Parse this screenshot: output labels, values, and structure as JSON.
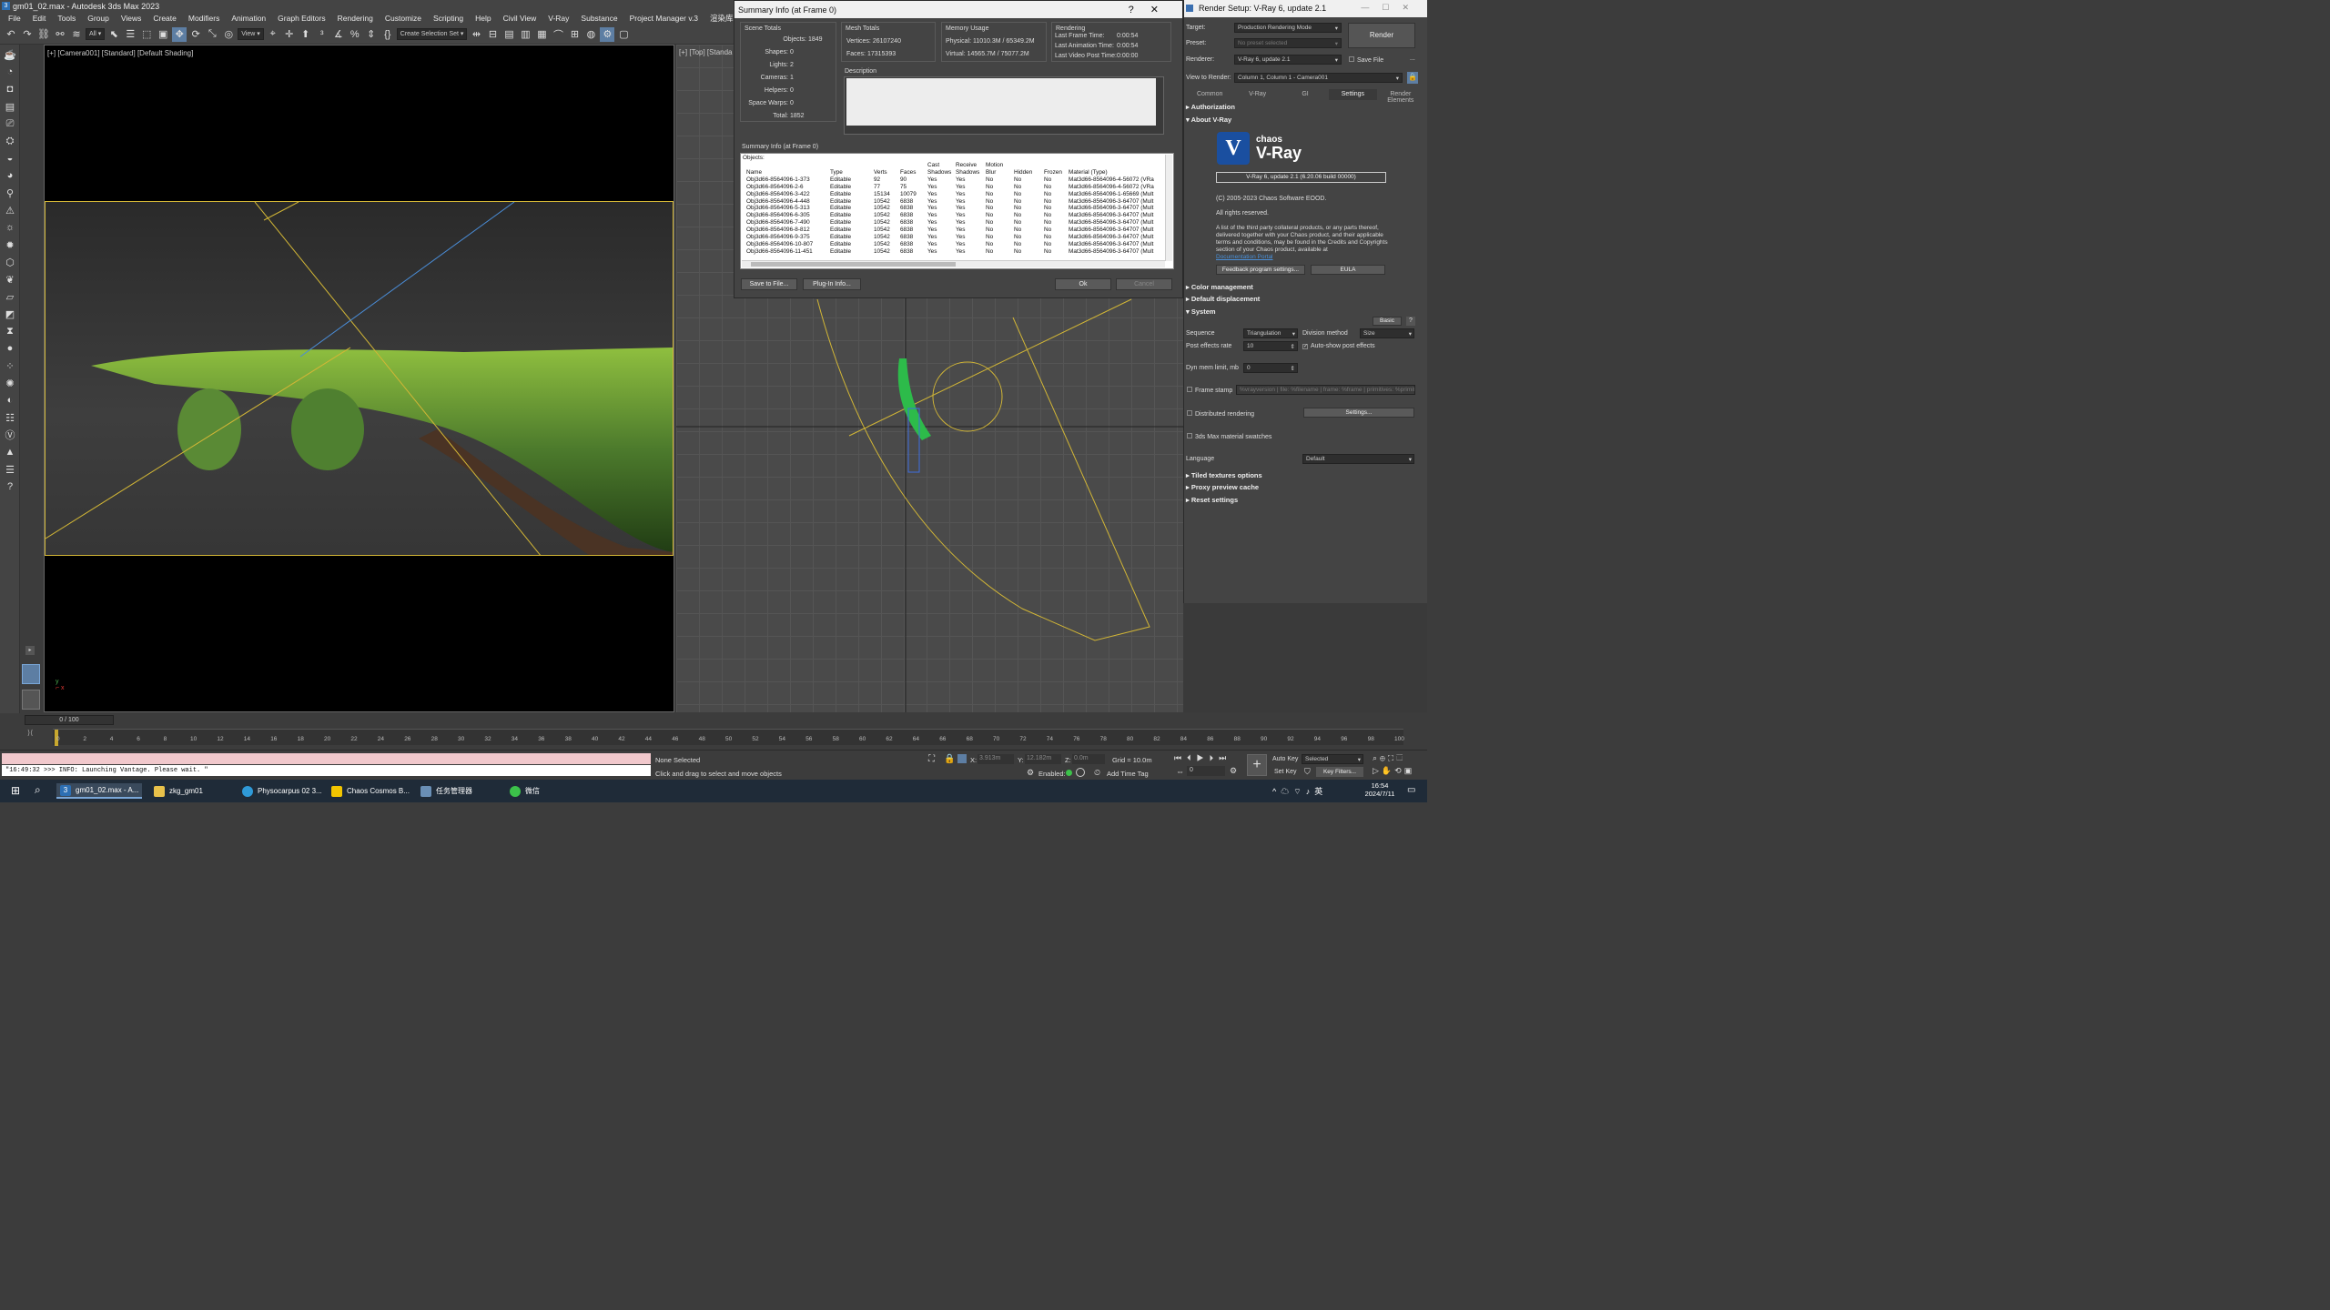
{
  "app": {
    "title": "gm01_02.max - Autodesk 3ds Max 2023",
    "menu": [
      "File",
      "Edit",
      "Tools",
      "Group",
      "Views",
      "Create",
      "Modifiers",
      "Animation",
      "Graph Editors",
      "Rendering",
      "Customize",
      "Scripting",
      "Help",
      "Civil View",
      "V-Ray",
      "Substance",
      "Project Manager v.3",
      "渲染库",
      "小图"
    ],
    "toolbar": {
      "filter": "All",
      "view": "View",
      "selection_set": "Create Selection Set"
    }
  },
  "viewport_left": {
    "label": "[+] [Camera001] [Standard] [Default Shading]"
  },
  "viewport_right": {
    "label": "[+] [Top] [Standa"
  },
  "summary": {
    "title": "Summary Info (at Frame 0)",
    "help": "?",
    "close": "✕",
    "scene_totals": {
      "heading": "Scene Totals",
      "rows": [
        {
          "label": "Objects:",
          "value": "1849"
        },
        {
          "label": "Shapes:",
          "value": "0"
        },
        {
          "label": "Lights:",
          "value": "2"
        },
        {
          "label": "Cameras:",
          "value": "1"
        },
        {
          "label": "Helpers:",
          "value": "0"
        },
        {
          "label": "Space Warps:",
          "value": "0"
        },
        {
          "label": "Total:",
          "value": "1852"
        }
      ]
    },
    "mesh_totals": {
      "heading": "Mesh Totals",
      "rows": [
        {
          "label": "Vertices:",
          "value": "26107240"
        },
        {
          "label": "Faces:",
          "value": "17315393"
        }
      ]
    },
    "memory": {
      "heading": "Memory Usage",
      "rows": [
        {
          "label": "Physical:",
          "value": "11010.3M / 65349.2M"
        },
        {
          "label": "Virtual:",
          "value": "14565.7M / 75077.2M"
        }
      ]
    },
    "rendering": {
      "heading": "Rendering",
      "rows": [
        {
          "label": "Last Frame Time:",
          "value": "0:00:54"
        },
        {
          "label": "Last Animation Time:",
          "value": "0:00:54"
        },
        {
          "label": "Last Video Post Time:",
          "value": "0:00:00"
        }
      ]
    },
    "description_label": "Description",
    "list_label": "Summary Info (at Frame 0)",
    "objects_label": "Objects:",
    "columns": [
      "Name",
      "Type",
      "Verts",
      "Faces",
      "Cast Shadows",
      "Receive Shadows",
      "Motion Blur",
      "Hidden",
      "Frozen",
      "Material (Type)"
    ],
    "rows": [
      [
        "Obj3d66-8564096-1-373",
        "Editable",
        "92",
        "90",
        "Yes",
        "Yes",
        "No",
        "No",
        "No",
        "Mat3d66-8564096-4-56072 (VRa"
      ],
      [
        "Obj3d66-8564096-2-6",
        "Editable",
        "77",
        "75",
        "Yes",
        "Yes",
        "No",
        "No",
        "No",
        "Mat3d66-8564096-4-56072 (VRa"
      ],
      [
        "Obj3d66-8564096-3-422",
        "Editable",
        "15134",
        "10079",
        "Yes",
        "Yes",
        "No",
        "No",
        "No",
        "Mat3d66-8564096-1-65669 (Mult"
      ],
      [
        "Obj3d66-8564096-4-448",
        "Editable",
        "10542",
        "6838",
        "Yes",
        "Yes",
        "No",
        "No",
        "No",
        "Mat3d66-8564096-3-64707 (Mult"
      ],
      [
        "Obj3d66-8564096-5-313",
        "Editable",
        "10542",
        "6838",
        "Yes",
        "Yes",
        "No",
        "No",
        "No",
        "Mat3d66-8564096-3-64707 (Mult"
      ],
      [
        "Obj3d66-8564096-6-305",
        "Editable",
        "10542",
        "6838",
        "Yes",
        "Yes",
        "No",
        "No",
        "No",
        "Mat3d66-8564096-3-64707 (Mult"
      ],
      [
        "Obj3d66-8564096-7-490",
        "Editable",
        "10542",
        "6838",
        "Yes",
        "Yes",
        "No",
        "No",
        "No",
        "Mat3d66-8564096-3-64707 (Mult"
      ],
      [
        "Obj3d66-8564096-8-812",
        "Editable",
        "10542",
        "6838",
        "Yes",
        "Yes",
        "No",
        "No",
        "No",
        "Mat3d66-8564096-3-64707 (Mult"
      ],
      [
        "Obj3d66-8564096-9-375",
        "Editable",
        "10542",
        "6838",
        "Yes",
        "Yes",
        "No",
        "No",
        "No",
        "Mat3d66-8564096-3-64707 (Mult"
      ],
      [
        "Obj3d66-8564096-10-807",
        "Editable",
        "10542",
        "6838",
        "Yes",
        "Yes",
        "No",
        "No",
        "No",
        "Mat3d66-8564096-3-64707 (Mult"
      ],
      [
        "Obj3d66-8564096-11-451",
        "Editable",
        "10542",
        "6838",
        "Yes",
        "Yes",
        "No",
        "No",
        "No",
        "Mat3d66-8564096-3-64707 (Mult"
      ]
    ],
    "buttons": {
      "save": "Save to File...",
      "plugin": "Plug-In Info...",
      "ok": "Ok",
      "cancel": "Cancel"
    }
  },
  "render_setup": {
    "title": "Render Setup: V-Ray 6, update 2.1",
    "target_label": "Target:",
    "target": "Production Rendering Mode",
    "preset_label": "Preset:",
    "preset": "No preset selected",
    "renderer_label": "Renderer:",
    "renderer": "V-Ray 6, update 2.1",
    "save_file": "Save File",
    "view_label": "View to Render:",
    "view": "Column 1, Column 1 - Camera001",
    "render_button": "Render",
    "tabs": [
      "Common",
      "V-Ray",
      "GI",
      "Settings",
      "Render Elements"
    ],
    "sections": {
      "authorization": "Authorization",
      "about": "About V-Ray",
      "color": "Color management",
      "displacement": "Default displacement",
      "system": "System",
      "tiled": "Tiled textures options",
      "proxy": "Proxy preview cache",
      "reset": "Reset settings"
    },
    "about": {
      "brand_small": "chaos",
      "brand_big": "V-Ray",
      "version": "V-Ray 6, update 2.1 (6.20.06 build 00000)",
      "copyright": "(C) 2005-2023 Chaos Software EOOD.",
      "rights": "All rights reserved.",
      "notice": "A list of the third party collateral products, or any parts thereof, delivered together with your Chaos product, and their applicable terms and conditions, may be found in the Credits and Copyrights section of your Chaos product, available at",
      "link": "Documentation Portal",
      "feedback": "Feedback program settings...",
      "eula": "EULA"
    },
    "system": {
      "basic": "Basic",
      "sequence_label": "Sequence",
      "sequence": "Triangulation",
      "division_label": "Division method",
      "division": "Size",
      "post_label": "Post effects rate",
      "post": "10",
      "autoshow": "Auto-show post effects",
      "dyn_label": "Dyn mem limit, mb",
      "dyn": "0",
      "frame_stamp": "Frame stamp",
      "frame_stamp_text": "%vrayversion | file: %filename | frame: %frame | primitives: %primitives | render time: %rendertime",
      "distributed": "Distributed rendering",
      "dist_settings": "Settings...",
      "swatches": "3ds Max material swatches",
      "language_label": "Language",
      "language": "Default"
    }
  },
  "timeline": {
    "frame": "0 / 100",
    "ticks": [
      "0",
      "2",
      "4",
      "6",
      "8",
      "10",
      "12",
      "14",
      "16",
      "18",
      "20",
      "22",
      "24",
      "26",
      "28",
      "30",
      "32",
      "34",
      "36",
      "38",
      "40",
      "42",
      "44",
      "46",
      "48",
      "50",
      "52",
      "54",
      "56",
      "58",
      "60",
      "62",
      "64",
      "66",
      "68",
      "70",
      "72",
      "74",
      "76",
      "78",
      "80",
      "82",
      "84",
      "86",
      "88",
      "90",
      "92",
      "94",
      "96",
      "98",
      "100"
    ]
  },
  "status": {
    "log": "\"16:49:32 >>> INFO: Launching Vantage. Please wait. \"",
    "selected": "None Selected",
    "hint": "Click and drag to select and move objects",
    "x_label": "X:",
    "x": "3.913m",
    "y_label": "Y:",
    "y": "12.182m",
    "z_label": "Z:",
    "z": "0.0m",
    "grid": "Grid = 10.0m",
    "enabled": "Enabled:",
    "add_time_tag": "Add Time Tag",
    "auto_key": "Auto Key",
    "selected_mode": "Selected",
    "set_key": "Set Key",
    "key_filters": "Key Filters...",
    "frame_value": "0"
  },
  "taskbar": {
    "items": [
      {
        "label": "gm01_02.max - A...",
        "icon": "3ds-max-icon"
      },
      {
        "label": "zkg_gm01",
        "icon": "folder-icon"
      },
      {
        "label": "Physocarpus 02 3...",
        "icon": "edge-icon"
      },
      {
        "label": "Chaos Cosmos B...",
        "icon": "chaos-icon"
      },
      {
        "label": "任务管理器",
        "icon": "task-manager-icon"
      },
      {
        "label": "微信",
        "icon": "wechat-icon"
      }
    ],
    "time": "16:54",
    "date": "2024/7/11"
  },
  "colors": {
    "accent": "#5d7ea3",
    "selection_yellow": "#d2b636",
    "foliage": "#4c7a2c",
    "taskbar": "#1f2b38"
  }
}
